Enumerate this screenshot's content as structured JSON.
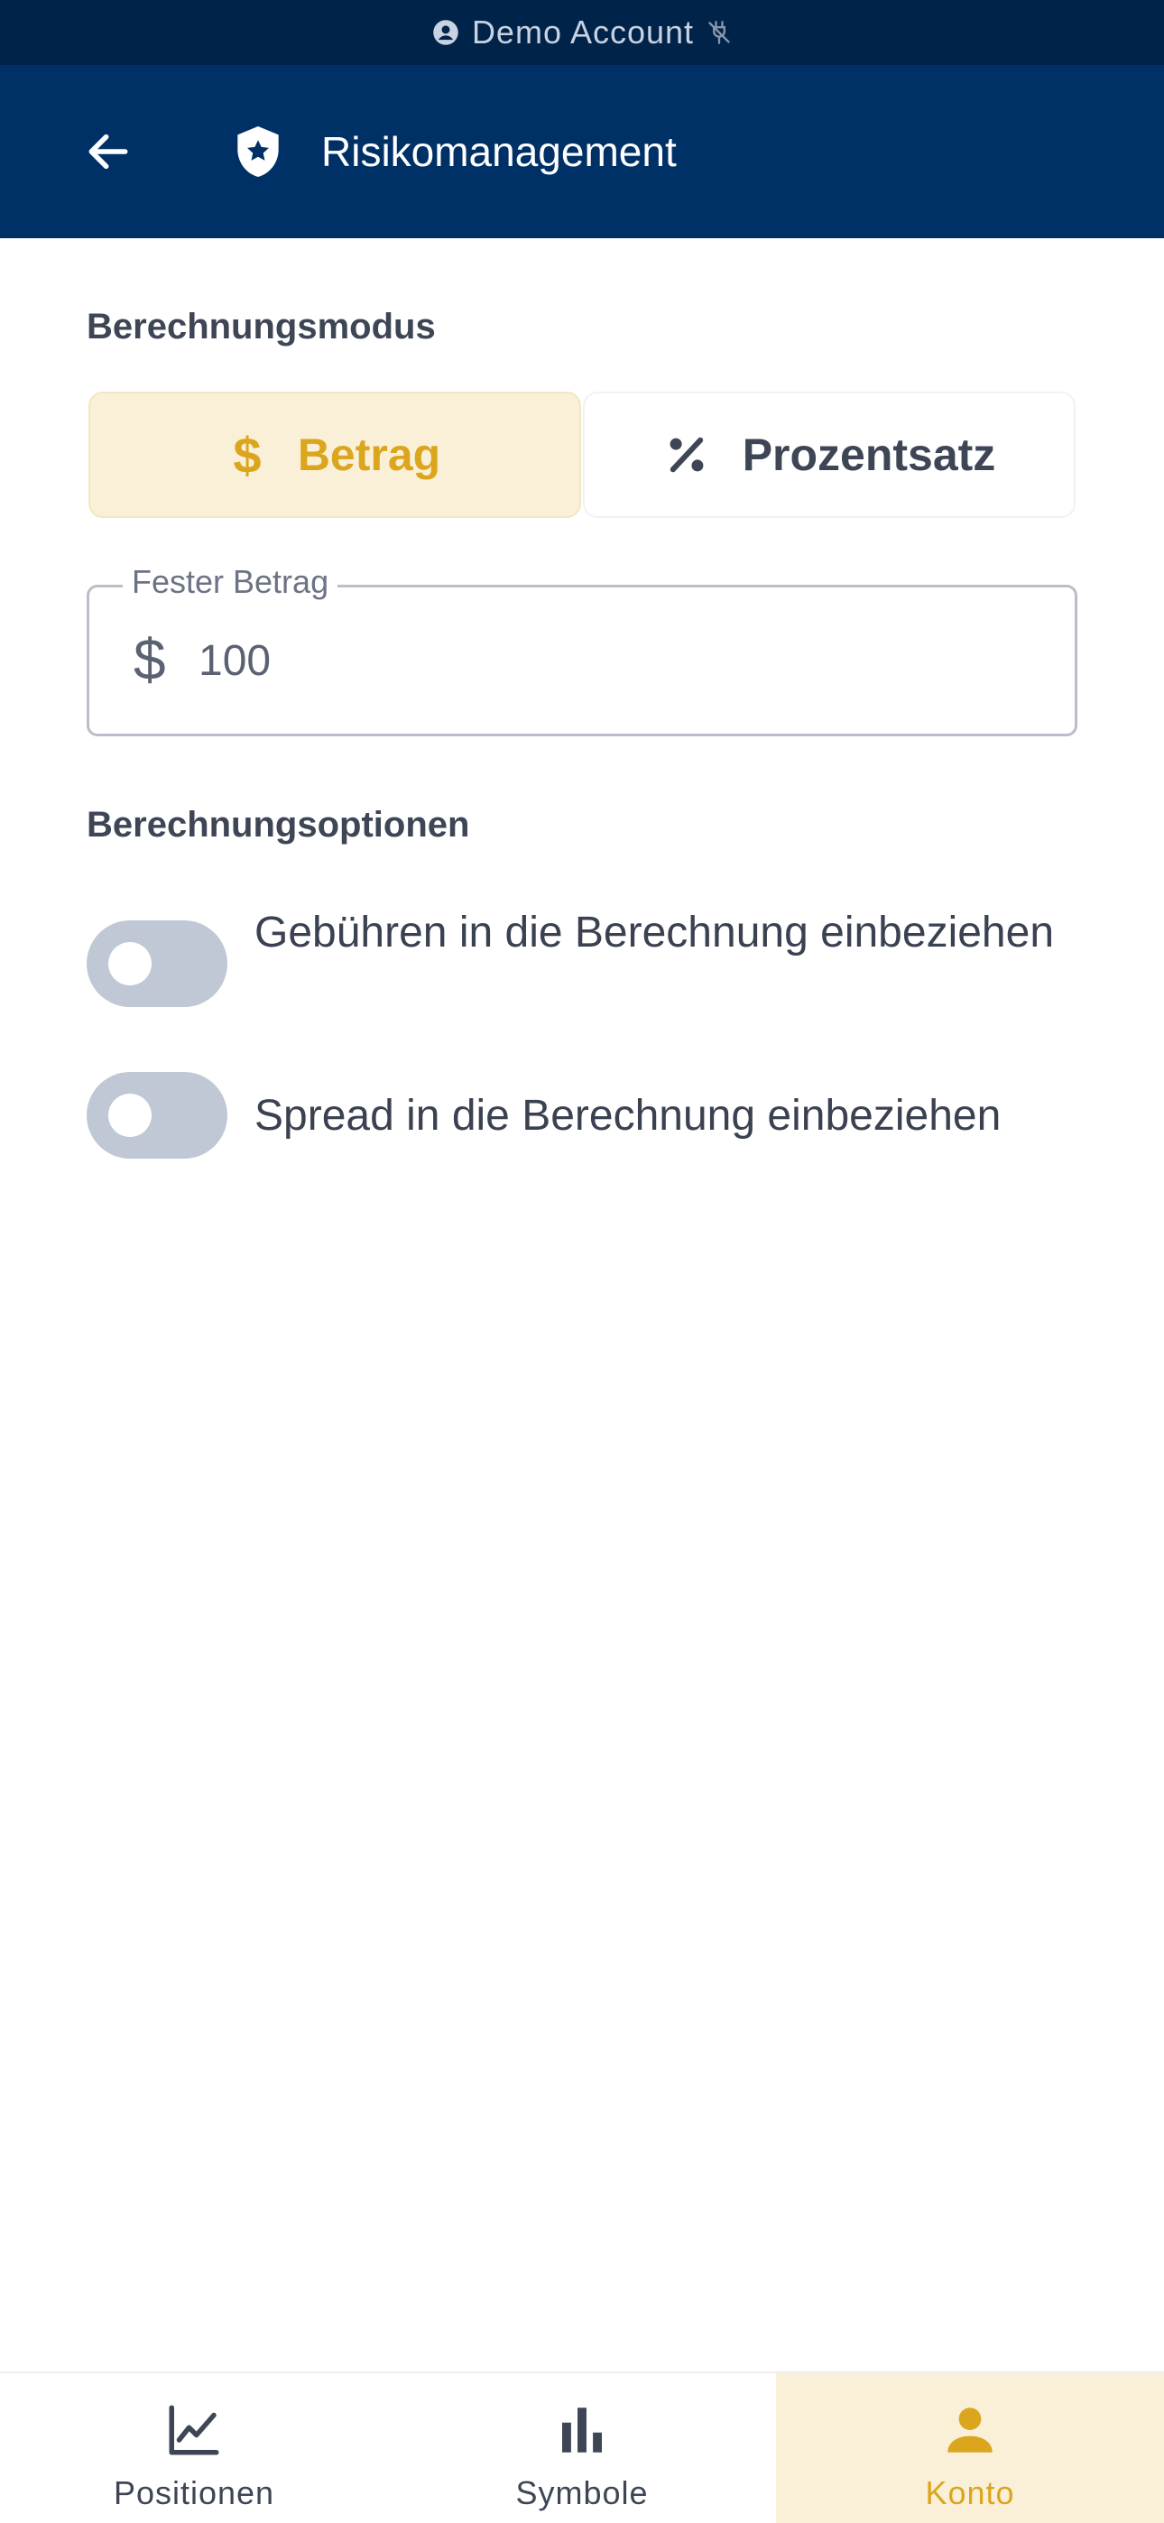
{
  "status_bar": {
    "label": "Demo Account"
  },
  "app_bar": {
    "title": "Risikomanagement"
  },
  "calculation_mode": {
    "section_label": "Berechnungsmodus",
    "options": [
      {
        "label": "Betrag",
        "icon": "dollar-icon",
        "selected": true
      },
      {
        "label": "Prozentsatz",
        "icon": "percent-icon",
        "selected": false
      }
    ]
  },
  "fixed_amount": {
    "label": "Fester Betrag",
    "prefix": "$",
    "value": "100"
  },
  "calculation_options": {
    "section_label": "Berechnungsoptionen",
    "toggles": [
      {
        "label": "Gebühren in die Berechnung einbeziehen",
        "on": false
      },
      {
        "label": "Spread in die Berechnung einbeziehen",
        "on": false
      }
    ]
  },
  "bottom_nav": {
    "items": [
      {
        "label": "Positionen",
        "icon": "line-chart-icon",
        "active": false
      },
      {
        "label": "Symbole",
        "icon": "bar-chart-icon",
        "active": false
      },
      {
        "label": "Konto",
        "icon": "person-icon",
        "active": true
      }
    ]
  },
  "colors": {
    "primary_navy": "#003166",
    "status_navy": "#00234a",
    "accent_gold": "#dca51e",
    "accent_bg": "#faf0d8",
    "toggle_off": "#c0c8d6"
  }
}
